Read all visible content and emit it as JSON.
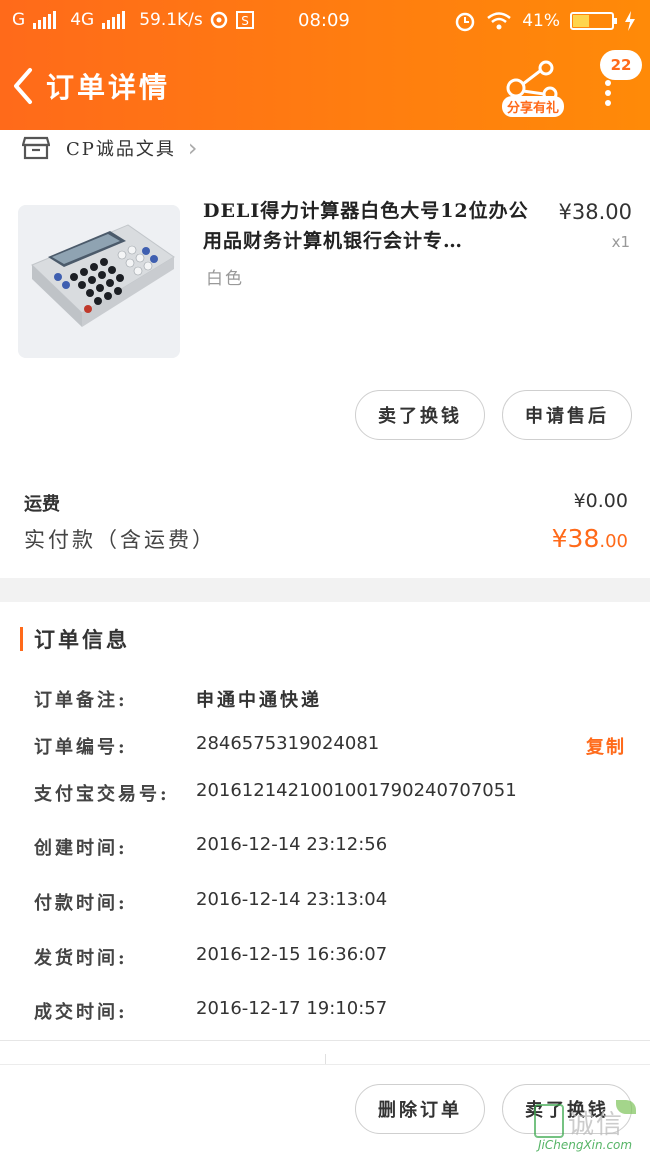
{
  "status_bar": {
    "carrier": "G",
    "network": "4G",
    "speed": "59.1K/s",
    "time": "08:09",
    "battery": "41%",
    "battery_level": 0.41
  },
  "header": {
    "title": "订单详情",
    "share_label": "分享有礼",
    "message_count": "22",
    "accent_color": "#ff6a1a"
  },
  "shop": {
    "name": "CP诚品文具"
  },
  "product": {
    "title": "DELI得力计算器白色大号12位办公用品财务计算机银行会计专…",
    "variant": "白色",
    "price": "¥38.00",
    "quantity": "x1",
    "actions": [
      "卖了换钱",
      "申请售后"
    ]
  },
  "totals": {
    "freight_label": "运费",
    "freight_value": "¥0.00",
    "paid_label": "实付款（含运费）",
    "paid_integer": "¥38",
    "paid_decimal": ".00"
  },
  "order_info": {
    "title": "订单信息",
    "copy_label": "复制",
    "rows": [
      {
        "label": "订单备注:",
        "value": "申通中通快递"
      },
      {
        "label": "订单编号:",
        "value": "2846575319024081"
      },
      {
        "label": "支付宝交易号:",
        "value": "2016121421001001790240707051"
      },
      {
        "label": "创建时间:",
        "value": "2016-12-14 23:12:56"
      },
      {
        "label": "付款时间:",
        "value": "2016-12-14 23:13:04"
      },
      {
        "label": "发货时间:",
        "value": "2016-12-15 16:36:07"
      },
      {
        "label": "成交时间:",
        "value": "2016-12-17 19:10:57"
      }
    ]
  },
  "bottom_bar": {
    "actions": [
      "删除订单",
      "卖了换钱"
    ]
  },
  "watermark": {
    "chars": "诚信",
    "site": "JiChengXin.com"
  }
}
